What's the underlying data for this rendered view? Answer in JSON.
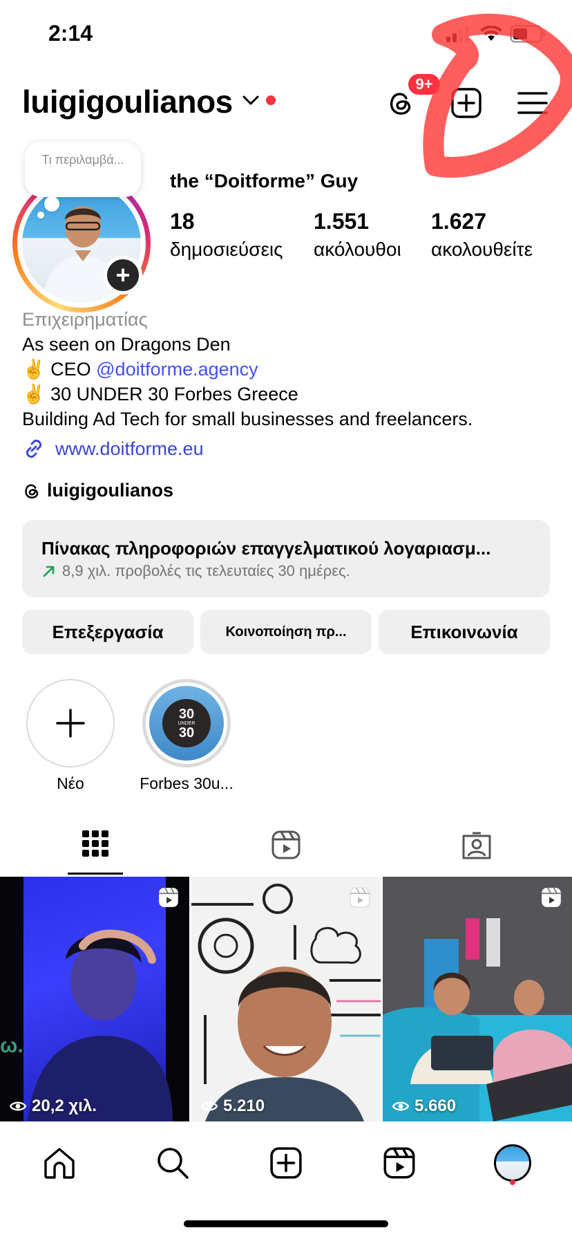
{
  "status_bar": {
    "time": "2:14"
  },
  "header": {
    "username": "luigigoulianos",
    "threads_badge": "9+",
    "icons": [
      "threads-icon",
      "new-post-icon",
      "menu-icon",
      "chevron-down-icon"
    ]
  },
  "note": {
    "text": "Τι περιλαμβά..."
  },
  "profile": {
    "full_name": "the “Doitforme” Guy",
    "stats": [
      {
        "value": "18",
        "label": "δημοσιεύσεις"
      },
      {
        "value": "1.551",
        "label": "ακόλουθοι"
      },
      {
        "value": "1.627",
        "label": "ακολουθείτε"
      }
    ],
    "bio": {
      "category": "Επιχειρηματίας",
      "line1": "As seen on Dragons Den",
      "line2_prefix": "✌️ CEO ",
      "line2_mention": "@doitforme.agency",
      "line3": "✌️ 30 UNDER 30 Forbes Greece",
      "line4": "Building Ad Tech for small businesses and freelancers."
    },
    "website": "www.doitforme.eu",
    "threads_handle": "luigigoulianos"
  },
  "dashboard": {
    "title": "Πίνακας πληροφοριών επαγγελματικού λογαριασμ...",
    "subtitle": "8,9 χιλ. προβολές τις τελευταίες 30 ημέρες."
  },
  "buttons": {
    "edit": "Επεξεργασία",
    "share": "Κοινοποίηση πρ...",
    "contact": "Επικοινωνία"
  },
  "highlights": [
    {
      "label": "Νέο"
    },
    {
      "label": "Forbes 30u...",
      "badge_top": "30",
      "badge_mid": "UNDER",
      "badge_bottom": "30"
    }
  ],
  "tabs": [
    "grid-icon",
    "reels-icon",
    "tagged-icon"
  ],
  "posts": [
    {
      "views": "20,2 χιλ.",
      "corner_text": "ω."
    },
    {
      "views": "5.210"
    },
    {
      "views": "5.660"
    }
  ],
  "bottom_nav": [
    "home-icon",
    "search-icon",
    "create-icon",
    "reels-icon",
    "profile-avatar"
  ],
  "colors": {
    "accent_link": "#4150f7",
    "notification_red": "#ff3040",
    "button_bg": "#efefef",
    "annotation_red": "#ff3b3b"
  }
}
